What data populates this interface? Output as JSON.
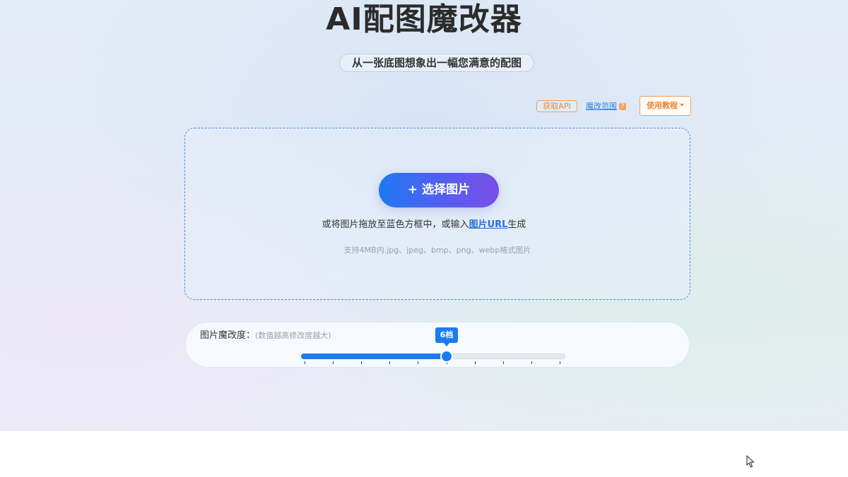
{
  "header": {
    "title": "AI配图魔改器",
    "subtitle": "从一张底图想象出一幅您满意的配图"
  },
  "toolbar": {
    "api_label": "获取API",
    "range_label": "魔改范围",
    "range_help_icon": "?",
    "tutorial_label": "使用教程"
  },
  "upload": {
    "choose_label": "+ 选择图片",
    "hint_prefix": "或将图片拖放至蓝色方框中，或输入",
    "hint_link": "图片URL",
    "hint_suffix": "生成",
    "formats": "支持4MB内.jpg、jpeg、bmp、png、webp格式图片"
  },
  "slider": {
    "label": "图片魔改度：",
    "note": "(数值越高修改度越大)",
    "value_label": "6档",
    "value": 6,
    "min": 1,
    "max": 10
  },
  "colors": {
    "accent": "#1a7cf0",
    "warning": "#e8893a"
  },
  "icons": {
    "help": "question-square-icon",
    "dropdown": "caret-down-icon",
    "cursor": "mouse-pointer-icon"
  }
}
